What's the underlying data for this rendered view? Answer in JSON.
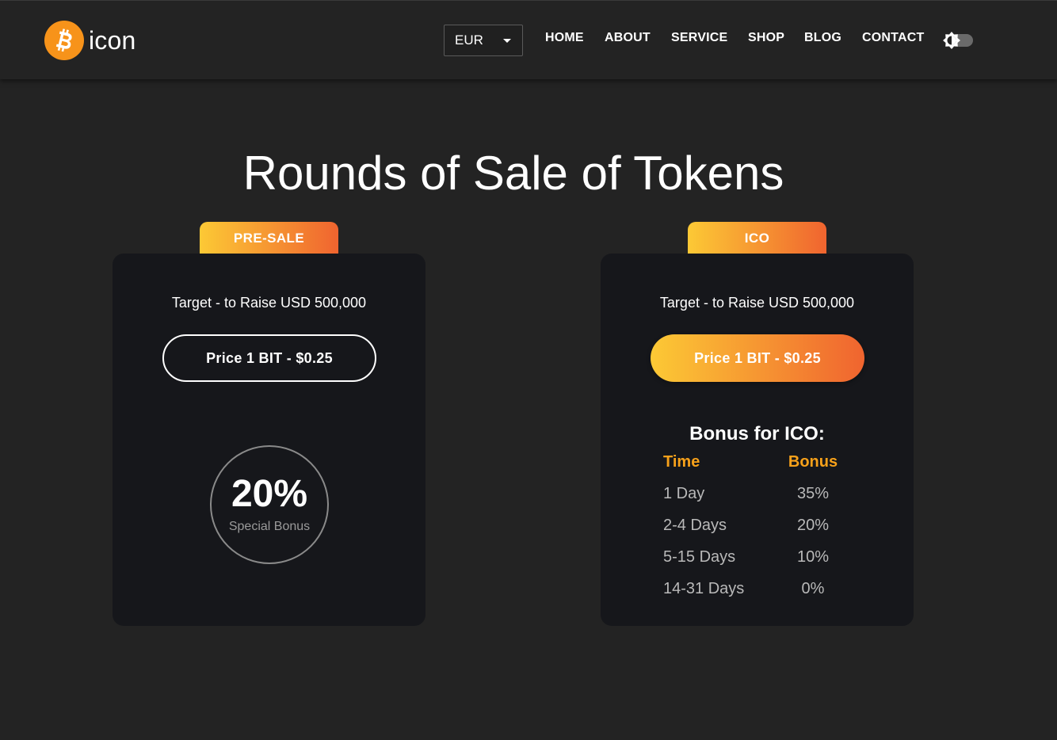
{
  "brand": {
    "name": "icon",
    "logo_icon": "bitcoin-icon",
    "logo_color": "#f7931a"
  },
  "currency": {
    "selected": "EUR"
  },
  "nav": {
    "items": [
      {
        "label": "HOME"
      },
      {
        "label": "ABOUT"
      },
      {
        "label": "SERVICE"
      },
      {
        "label": "SHOP"
      },
      {
        "label": "BLOG"
      },
      {
        "label": "CONTACT"
      }
    ],
    "theme_toggle_icon": "theme-toggle-icon"
  },
  "section": {
    "title": "Rounds of Sale of Tokens"
  },
  "colors": {
    "background": "#232323",
    "card": "#16171b",
    "accent_start": "#fcc935",
    "accent_end": "#f0642f",
    "bonus_header": "#f7a11a"
  },
  "cards": [
    {
      "tab": "PRE-SALE",
      "target": "Target - to Raise USD 500,000",
      "price": "Price 1 BIT - $0.25",
      "bonus_percent": "20%",
      "bonus_label": "Special Bonus"
    },
    {
      "tab": "ICO",
      "target": "Target - to Raise USD 500,000",
      "price": "Price 1 BIT - $0.25",
      "bonus_title": "Bonus for ICO:",
      "table": {
        "headers": [
          "Time",
          "Bonus"
        ],
        "rows": [
          [
            "1 Day",
            "35%"
          ],
          [
            "2-4 Days",
            "20%"
          ],
          [
            "5-15 Days",
            "10%"
          ],
          [
            "14-31 Days",
            "0%"
          ]
        ]
      }
    }
  ]
}
